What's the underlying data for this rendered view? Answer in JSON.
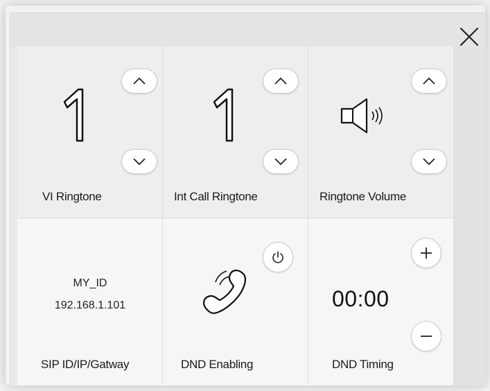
{
  "tiles": {
    "vi_ringtone": {
      "label": "VI Ringtone",
      "value": "1"
    },
    "int_call_ringtone": {
      "label": "Int Call Ringtone",
      "value": "1"
    },
    "ringtone_volume": {
      "label": "Ringtone Volume"
    },
    "sip": {
      "label": "SIP ID/IP/Gatway",
      "id": "MY_ID",
      "ip": "192.168.1.101"
    },
    "dnd_enabling": {
      "label": "DND Enabling"
    },
    "dnd_timing": {
      "label": "DND Timing",
      "value": "00:00"
    }
  },
  "icons": {
    "close": "close-icon",
    "up": "chevron-up-icon",
    "down": "chevron-down-icon",
    "speaker": "speaker-icon",
    "phone": "phone-icon",
    "power": "power-icon",
    "plus": "plus-icon",
    "minus": "minus-icon"
  },
  "colors": {
    "background": "#e9e9e9",
    "tile": "#f0f0f0",
    "button_fill": "#ffffff",
    "button_border": "#c9c9c9",
    "text": "#1a1a1a"
  }
}
